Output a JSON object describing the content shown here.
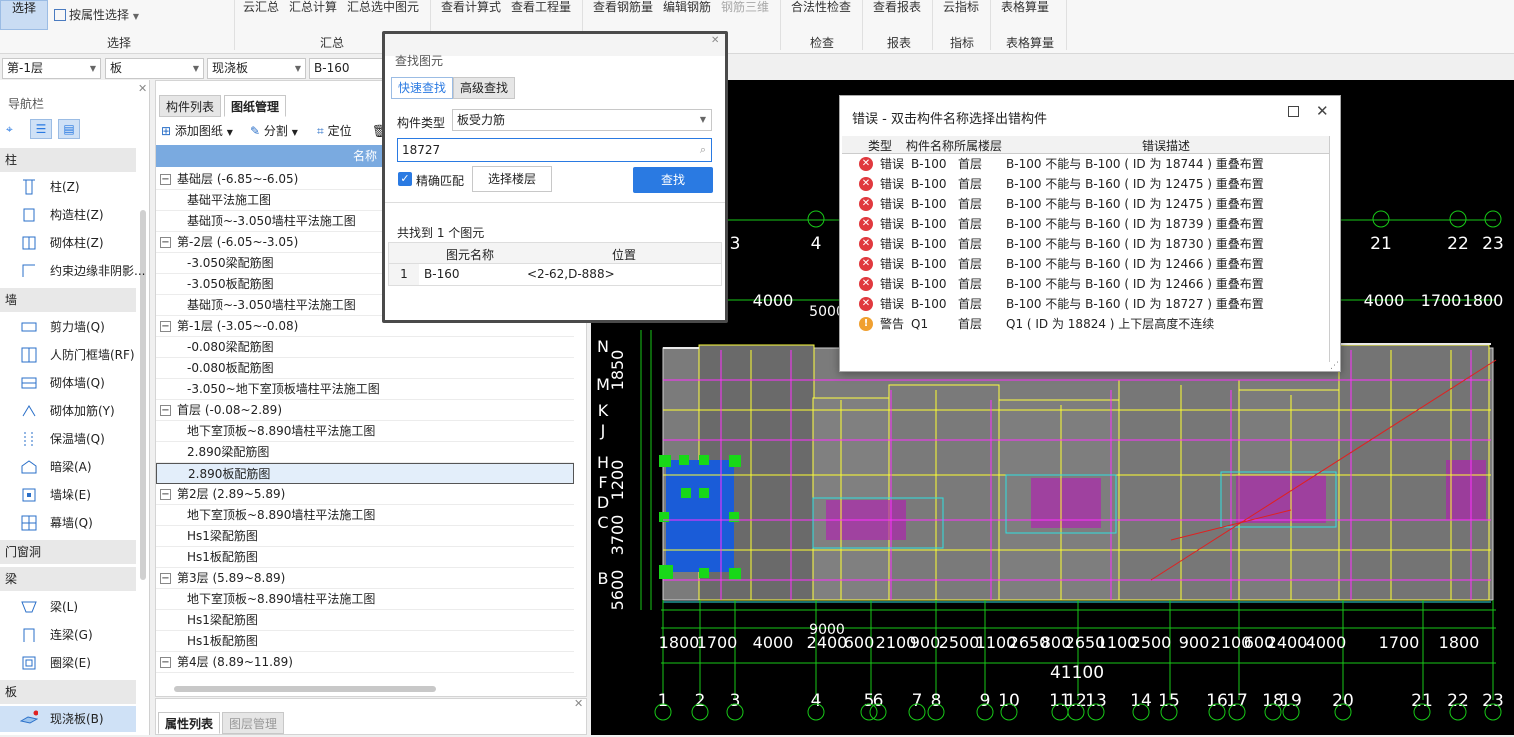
{
  "ribbon": {
    "select_btn": "选择",
    "attr_select": "按属性选择",
    "group_select": "选择",
    "btns": [
      "云汇总",
      "汇总计算",
      "汇总选中图元",
      "查看计算式",
      "查看工程量",
      "查看钢筋量",
      "编辑钢筋",
      "钢筋三维",
      "合法性检查",
      "查看报表",
      "云指标",
      "表格算量"
    ],
    "groups": [
      "汇总",
      "检查",
      "报表",
      "指标",
      "表格算量"
    ]
  },
  "dropdowns": [
    "第-1层",
    "板",
    "现浇板",
    "B-160"
  ],
  "nav": {
    "title": "导航栏",
    "categories": [
      "柱",
      "墙",
      "门窗洞",
      "梁",
      "板"
    ],
    "items": [
      "柱(Z)",
      "构造柱(Z)",
      "砌体柱(Z)",
      "约束边缘非阴影...",
      "剪力墙(Q)",
      "人防门框墙(RF)",
      "砌体墙(Q)",
      "砌体加筋(Y)",
      "保温墙(Q)",
      "暗梁(A)",
      "墙垛(E)",
      "幕墙(Q)",
      "梁(L)",
      "连梁(G)",
      "圈梁(E)",
      "现浇板(B)"
    ]
  },
  "drawing": {
    "tabs": [
      "构件列表",
      "图纸管理"
    ],
    "toolbar": [
      "添加图纸",
      "分割",
      "定位"
    ],
    "column_header": "名称",
    "tree": [
      {
        "g": "基础层 (-6.85~-6.05)",
        "items": [
          "基础平法施工图",
          "基础顶~-3.050墙柱平法施工图"
        ]
      },
      {
        "g": "第-2层 (-6.05~-3.05)",
        "items": [
          "-3.050梁配筋图",
          "-3.050板配筋图",
          "基础顶~-3.050墙柱平法施工图"
        ]
      },
      {
        "g": "第-1层 (-3.05~-0.08)",
        "items": [
          "-0.080梁配筋图",
          "-0.080板配筋图",
          "-3.050~地下室顶板墙柱平法施工图"
        ]
      },
      {
        "g": "首层 (-0.08~2.89)",
        "items": [
          "地下室顶板~8.890墙柱平法施工图",
          "2.890梁配筋图",
          "2.890板配筋图"
        ]
      },
      {
        "g": "第2层 (2.89~5.89)",
        "items": [
          "地下室顶板~8.890墙柱平法施工图",
          "Hs1梁配筋图",
          "Hs1板配筋图"
        ]
      },
      {
        "g": "第3层 (5.89~8.89)",
        "items": [
          "地下室顶板~8.890墙柱平法施工图",
          "Hs1梁配筋图",
          "Hs1板配筋图"
        ]
      },
      {
        "g": "第4层 (8.89~11.89)",
        "items": []
      }
    ]
  },
  "props": {
    "tabs": [
      "属性列表",
      "图层管理"
    ]
  },
  "find": {
    "title": "查找图元",
    "tabs": [
      "快速查找",
      "高级查找"
    ],
    "type_label": "构件类型",
    "type_value": "板受力筋",
    "search_value": "18727",
    "exact_label": "精确匹配",
    "floor_btn": "选择楼层",
    "find_btn": "查找",
    "result_text": "共找到 1 个图元",
    "col_name": "图元名称",
    "col_pos": "位置",
    "rows": [
      {
        "n": "1",
        "name": "B-160",
        "pos": "<2-62,D-888>"
      }
    ]
  },
  "errors": {
    "title": "错误 - 双击构件名称选择出错构件",
    "headers": [
      "类型",
      "构件名称",
      "所属楼层",
      "错误描述"
    ],
    "rows": [
      {
        "type": "错误",
        "name": "B-100",
        "floor": "首层",
        "desc": "B-100 不能与 B-100 ( ID 为 18744 ) 重叠布置"
      },
      {
        "type": "错误",
        "name": "B-100",
        "floor": "首层",
        "desc": "B-100 不能与 B-160 ( ID 为 12475 ) 重叠布置"
      },
      {
        "type": "错误",
        "name": "B-100",
        "floor": "首层",
        "desc": "B-100 不能与 B-160 ( ID 为 12475 ) 重叠布置"
      },
      {
        "type": "错误",
        "name": "B-100",
        "floor": "首层",
        "desc": "B-100 不能与 B-160 ( ID 为 18739 ) 重叠布置"
      },
      {
        "type": "错误",
        "name": "B-100",
        "floor": "首层",
        "desc": "B-100 不能与 B-160 ( ID 为 18730 ) 重叠布置"
      },
      {
        "type": "错误",
        "name": "B-100",
        "floor": "首层",
        "desc": "B-100 不能与 B-160 ( ID 为 12466 ) 重叠布置"
      },
      {
        "type": "错误",
        "name": "B-100",
        "floor": "首层",
        "desc": "B-100 不能与 B-160 ( ID 为 12466 ) 重叠布置"
      },
      {
        "type": "错误",
        "name": "B-100",
        "floor": "首层",
        "desc": "B-100 不能与 B-160 ( ID 为 18727 ) 重叠布置"
      },
      {
        "type": "警告",
        "name": "Q1",
        "floor": "首层",
        "desc": "Q1 ( ID 为 18824 ) 上下层高度不连续"
      }
    ]
  },
  "cad": {
    "bottom_dims": [
      "1800",
      "1700",
      "4000",
      "2400",
      "600",
      "2100",
      "900",
      "2500",
      "1100",
      "2650",
      "800",
      "2650",
      "1100",
      "2500",
      "900",
      "2100",
      "600",
      "2400",
      "4000",
      "1700",
      "1800"
    ],
    "top_dims": [
      "4000",
      "4000",
      "1700",
      "1800"
    ],
    "total_dim": "41100",
    "axis_top": [
      "3",
      "4",
      "21",
      "22",
      "23"
    ],
    "axis_bottom": [
      "1",
      "2",
      "3",
      "4",
      "5",
      "6",
      "7",
      "8",
      "9",
      "10",
      "11",
      "12",
      "13",
      "14",
      "15",
      "16",
      "17",
      "18",
      "19",
      "20",
      "21",
      "22",
      "23"
    ],
    "row_letters": [
      "N",
      "M",
      "K",
      "J",
      "H",
      "F",
      "D",
      "C",
      "B"
    ],
    "left_dims": [
      "1850",
      "1200",
      "3700",
      "5600"
    ],
    "mid_dim": "9000",
    "top_mid_dim": "5000"
  },
  "colors": {
    "error": "#e0393e",
    "warning": "#f0a030",
    "accent": "#2a7ae2",
    "header_blue": "#7aaae0"
  }
}
